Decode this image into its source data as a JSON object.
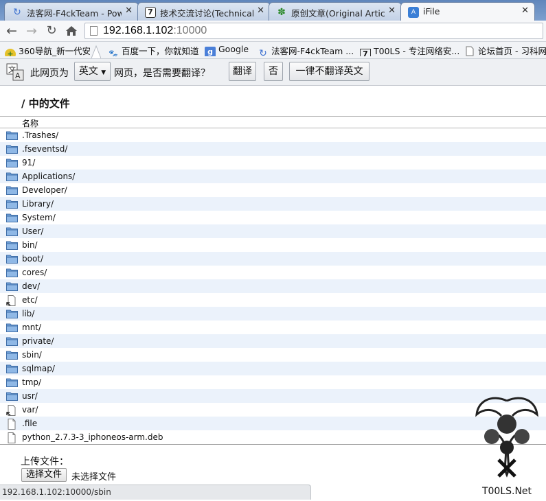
{
  "tabs": [
    {
      "label": "法客网-F4ckTeam - Pow",
      "icon": "spinner-icon"
    },
    {
      "label": "技术交流讨论(Technical D",
      "icon": "t00ls-icon"
    },
    {
      "label": "原创文章(Original Article",
      "icon": "green-logo-icon"
    },
    {
      "label": "iFile",
      "icon": "ifile-icon",
      "active": true
    }
  ],
  "toolbar": {
    "url_host": "192.168.1.102",
    "url_port": ":10000"
  },
  "bookmarks": [
    {
      "label": "360导航_新一代安...",
      "icon": "360-icon"
    },
    {
      "label": "百度一下，你就知道",
      "icon": "baidu-paw-icon"
    },
    {
      "label": "Google",
      "icon": "google-icon"
    },
    {
      "label": "法客网-F4ckTeam ...",
      "icon": "spinner-icon"
    },
    {
      "label": "T00LS - 专注网络安...",
      "icon": "t00ls-icon"
    },
    {
      "label": "论坛首页 - 习科网...",
      "icon": "page-icon"
    }
  ],
  "translate": {
    "prefix": "此网页为",
    "language": "英文",
    "question": "网页，是否需要翻译？",
    "translate_btn": "翻译",
    "no_btn": "否",
    "never_btn": "一律不翻译英文"
  },
  "page": {
    "heading": "/ 中的文件",
    "column_name": "名称",
    "files": [
      {
        "name": ".Trashes/",
        "type": "folder"
      },
      {
        "name": ".fseventsd/",
        "type": "folder"
      },
      {
        "name": "91/",
        "type": "folder"
      },
      {
        "name": "Applications/",
        "type": "folder"
      },
      {
        "name": "Developer/",
        "type": "folder"
      },
      {
        "name": "Library/",
        "type": "folder"
      },
      {
        "name": "System/",
        "type": "folder"
      },
      {
        "name": "User/",
        "type": "folder"
      },
      {
        "name": "bin/",
        "type": "folder"
      },
      {
        "name": "boot/",
        "type": "folder"
      },
      {
        "name": "cores/",
        "type": "folder"
      },
      {
        "name": "dev/",
        "type": "folder"
      },
      {
        "name": "etc/",
        "type": "symlink"
      },
      {
        "name": "lib/",
        "type": "folder"
      },
      {
        "name": "mnt/",
        "type": "folder"
      },
      {
        "name": "private/",
        "type": "folder"
      },
      {
        "name": "sbin/",
        "type": "folder"
      },
      {
        "name": "sqlmap/",
        "type": "folder"
      },
      {
        "name": "tmp/",
        "type": "folder"
      },
      {
        "name": "usr/",
        "type": "folder"
      },
      {
        "name": "var/",
        "type": "symlink"
      },
      {
        "name": ".file",
        "type": "file"
      },
      {
        "name": "python_2.7.3-3_iphoneos-arm.deb",
        "type": "file"
      }
    ],
    "upload_label": "上传文件：",
    "choose_file_btn": "选择文件",
    "no_file_selected": "未选择文件"
  },
  "status": {
    "hover_url": "192.168.1.102:10000/sbin"
  },
  "watermark": {
    "text": "T00LS.Net"
  },
  "colors": {
    "folder": "#4f86c6",
    "row_alt": "#ebf2fb",
    "tabstrip": "#6b8fc0"
  }
}
